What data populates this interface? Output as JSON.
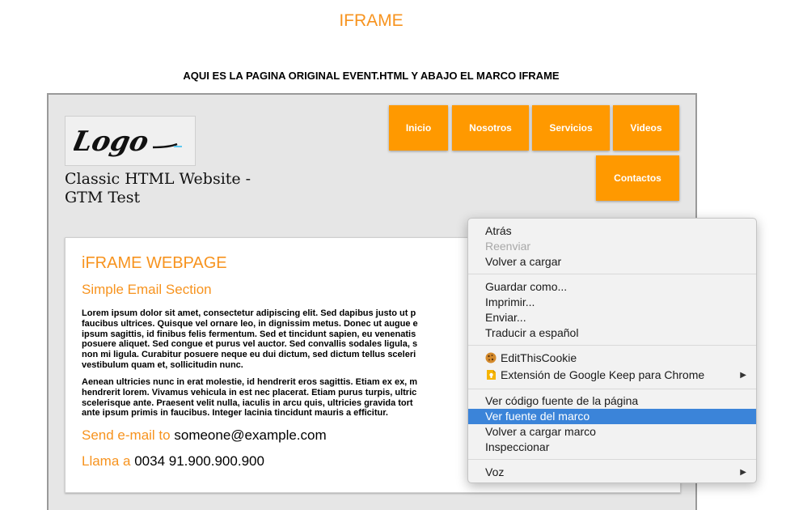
{
  "page": {
    "heading": "IFRAME",
    "subtitle": "AQUI ES LA PAGINA ORIGINAL EVENT.HTML Y ABAJO EL MARCO IFRAME"
  },
  "iframe": {
    "logo_text": "Logo",
    "site_title": "Classic HTML Website - GTM Test",
    "nav": [
      "Inicio",
      "Nosotros",
      "Servicios",
      "Videos",
      "Contactos"
    ],
    "card": {
      "title": "iFRAME WEBPAGE",
      "subtitle": "Simple Email Section",
      "paragraph1": "Lorem ipsum dolor sit amet, consectetur adipiscing elit. Sed dapibus justo ut p\nfaucibus ultrices. Quisque vel ornare leo, in dignissim metus. Donec ut augue e\nipsum sagittis, id finibus felis fermentum. Sed et tincidunt sapien, eu venenatis\nposuere aliquet. Sed congue et purus vel auctor. Sed convallis sodales ligula, s\nnon mi ligula. Curabitur posuere neque eu dui dictum, sed dictum tellus sceleri\nvestibulum quam et, sollicitudin nunc.",
      "paragraph2": "Aenean ultricies nunc in erat molestie, id hendrerit eros sagittis. Etiam ex ex, m\nhendrerit lorem. Vivamus vehicula in est nec placerat. Etiam purus turpis, ultric\nscelerisque ante. Praesent velit nulla, iaculis in arcu quis, ultricies gravida tort\nante ipsum primis in faucibus. Integer lacinia tincidunt mauris a efficitur.",
      "email_label": "Send e-mail to",
      "email_value": "someone@example.com",
      "phone_label": "Llama a",
      "phone_value": "0034 91.900.900.900"
    }
  },
  "context_menu": {
    "back": "Atrás",
    "forward": "Reenviar",
    "reload": "Volver a cargar",
    "save_as": "Guardar como...",
    "print": "Imprimir...",
    "send": "Enviar...",
    "translate": "Traducir a español",
    "edit_this_cookie": "EditThisCookie",
    "google_keep": "Extensión de Google Keep para Chrome",
    "view_source": "Ver código fuente de la página",
    "view_frame_source": "Ver fuente del marco",
    "reload_frame": "Volver a cargar marco",
    "inspect": "Inspeccionar",
    "voice": "Voz"
  },
  "colors": {
    "accent_orange": "#ff9900",
    "heading_orange": "#f7931e",
    "menu_selected": "#3b84d9"
  }
}
